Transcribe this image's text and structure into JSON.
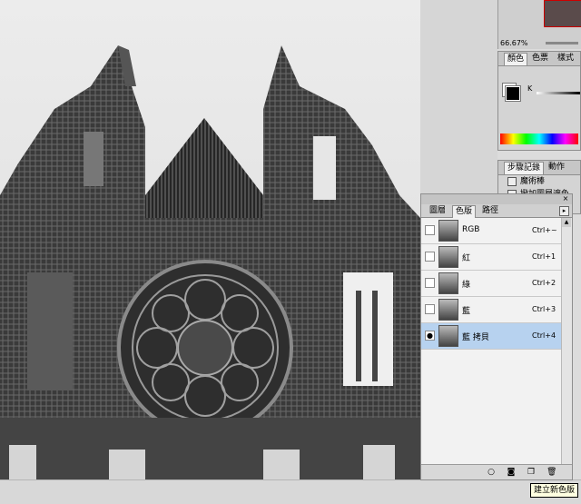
{
  "navigator": {
    "zoom": "66.67%"
  },
  "color_panel": {
    "tabs": [
      "顏色",
      "色票",
      "樣式"
    ],
    "active_tab": 0,
    "k_label": "K"
  },
  "history_panel": {
    "tabs": [
      "步驟記錄",
      "動作"
    ],
    "items": [
      "魔術棒",
      "撥加圖層遮色"
    ]
  },
  "channels_panel": {
    "tabs": [
      "圖層",
      "色版",
      "路徑"
    ],
    "active_tab": 1,
    "channels": [
      {
        "name": "RGB",
        "shortcut": "Ctrl+~",
        "visible": false,
        "selected": false
      },
      {
        "name": "紅",
        "shortcut": "Ctrl+1",
        "visible": false,
        "selected": false
      },
      {
        "name": "綠",
        "shortcut": "Ctrl+2",
        "visible": false,
        "selected": false
      },
      {
        "name": "藍",
        "shortcut": "Ctrl+3",
        "visible": false,
        "selected": false
      },
      {
        "name": "藍 拷貝",
        "shortcut": "Ctrl+4",
        "visible": true,
        "selected": true
      }
    ],
    "bottom_buttons": [
      "load-channel-as-selection-icon",
      "save-selection-as-channel-icon",
      "new-channel-icon",
      "delete-channel-icon"
    ]
  },
  "tooltip": "建立新色版",
  "colors": {
    "selection": "#b7d2ef",
    "panel_bg": "#f2f2f2"
  }
}
